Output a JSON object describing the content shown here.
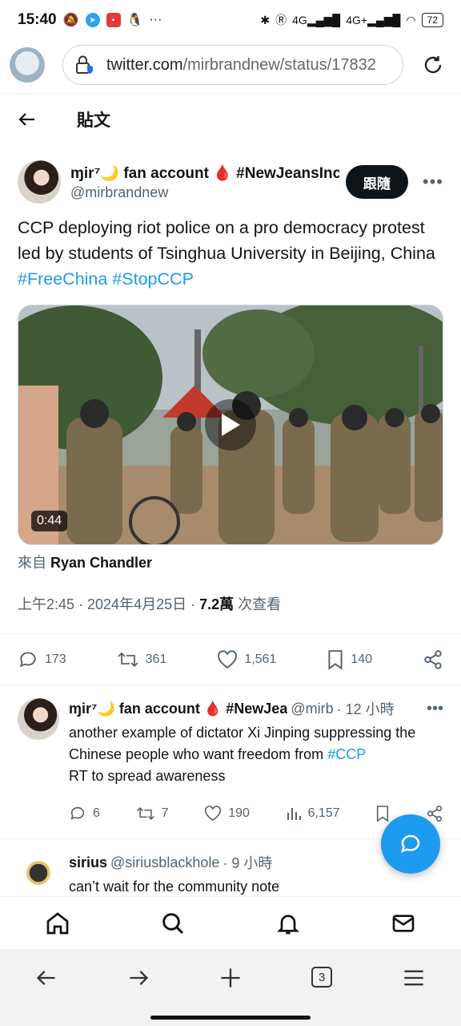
{
  "status_bar": {
    "time": "15:40",
    "battery": "72",
    "signal_1": "4G",
    "signal_2": "4G+"
  },
  "browser": {
    "url_host": "twitter.com",
    "url_path": "/mirbrandnew/status/17832",
    "tab_count": "3"
  },
  "header": {
    "title": "貼文"
  },
  "tweet": {
    "author_name": "ɱir⁷🌙 fan account 🩸 #NewJeansInc",
    "author_handle": "@mirbrandnew",
    "follow_label": "跟隨",
    "text_main": "CCP deploying riot police on a pro democracy protest led by students of Tsinghua University in Beijing, China",
    "hashtag_1": "#FreeChina",
    "hashtag_2": "#StopCCP",
    "video_duration": "0:44",
    "source_prefix": "來自",
    "source_name": "Ryan Chandler",
    "time": "上午2:45 · 2024年4月25日 · ",
    "views": "7.2萬",
    "views_label": " 次查看",
    "replies": "173",
    "retweets": "361",
    "likes": "1,561",
    "bookmarks": "140"
  },
  "reply1": {
    "author_name": "ɱir⁷🌙 fan account 🩸 #NewJea",
    "handle": "@mirb",
    "time": "· 12 小時",
    "text_before": "another example of dictator Xi Jinping suppressing the Chinese people who want freedom from",
    "hashtag": "#CCP",
    "text_after": "RT to spread awareness",
    "replies": "6",
    "retweets": "7",
    "likes": "190",
    "views": "6,157"
  },
  "reply2": {
    "author_name": "sirius",
    "handle": "@siriusblackhole",
    "time": "· 9 小時",
    "text": "can’t wait for the community note"
  },
  "colors": {
    "accent": "#1d9bf0",
    "text": "#0f1419",
    "muted": "#536471"
  }
}
